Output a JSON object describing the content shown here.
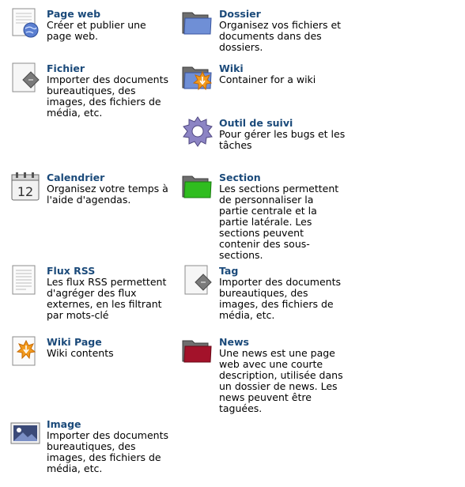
{
  "items": [
    {
      "key": "page-web",
      "title": "Page web",
      "desc": "Créer et publier une page web.",
      "icon": "page-web-icon"
    },
    {
      "key": "dossier",
      "title": "Dossier",
      "desc": "Organisez vos fichiers et documents dans des dossiers.",
      "icon": "folder-icon"
    },
    {
      "key": "fichier",
      "title": "Fichier",
      "desc": "Importer des documents bureautiques, des images, des fichiers de média, etc.",
      "icon": "file-icon"
    },
    {
      "key": "wiki",
      "title": "Wiki",
      "desc": "Container for a wiki",
      "icon": "wiki-folder-icon"
    },
    {
      "key": "outil-de-suivi",
      "title": "Outil de suivi",
      "desc": "Pour gérer les bugs et les tâches",
      "icon": "gear-icon"
    },
    {
      "key": "calendrier",
      "title": "Calendrier",
      "desc": "Organisez votre temps à l'aide d'agendas.",
      "icon": "calendar-icon"
    },
    {
      "key": "section",
      "title": "Section",
      "desc": "Les sections permettent de personnaliser la partie centrale et la partie latérale. Les sections peuvent contenir des sous-sections.",
      "icon": "green-folder-icon"
    },
    {
      "key": "flux-rss",
      "title": "Flux RSS",
      "desc": "Les flux RSS permettent d'agréger des flux externes, en les filtrant par mots-clé",
      "icon": "rss-document-icon"
    },
    {
      "key": "tag",
      "title": "Tag",
      "desc": "Importer des documents bureautiques, des images, des fichiers de média, etc.",
      "icon": "tag-file-icon"
    },
    {
      "key": "wiki-page",
      "title": "Wiki Page",
      "desc": "Wiki contents",
      "icon": "wiki-page-icon"
    },
    {
      "key": "news",
      "title": "News",
      "desc": "Une news est une page web avec une courte description, utilisée dans un dossier de news. Les news peuvent être taguées.",
      "icon": "red-folder-icon"
    },
    {
      "key": "image",
      "title": "Image",
      "desc": "Importer des documents bureautiques, des images, des fichiers de média, etc.",
      "icon": "image-icon"
    }
  ],
  "calendar_day": "12"
}
